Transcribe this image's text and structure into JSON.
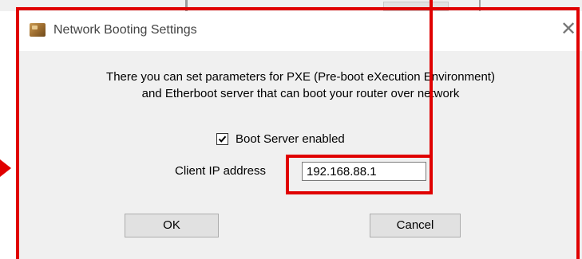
{
  "window": {
    "title": "Network Booting Settings"
  },
  "description": {
    "line1": "There you can set parameters for PXE (Pre-boot eXecution Environment)",
    "line2": "and Etherboot server that can boot your router over network"
  },
  "boot_server": {
    "label": "Boot Server enabled",
    "checked": true
  },
  "client_ip": {
    "label": "Client IP address",
    "value": "192.168.88.1"
  },
  "buttons": {
    "ok": "OK",
    "cancel": "Cancel"
  },
  "icons": {
    "app": "box-icon",
    "close": "close-icon",
    "check": "checkmark-icon"
  },
  "colors": {
    "annotation": "#e00000",
    "dialog_bg": "#f0f0f0",
    "titlebar_bg": "#ffffff"
  }
}
